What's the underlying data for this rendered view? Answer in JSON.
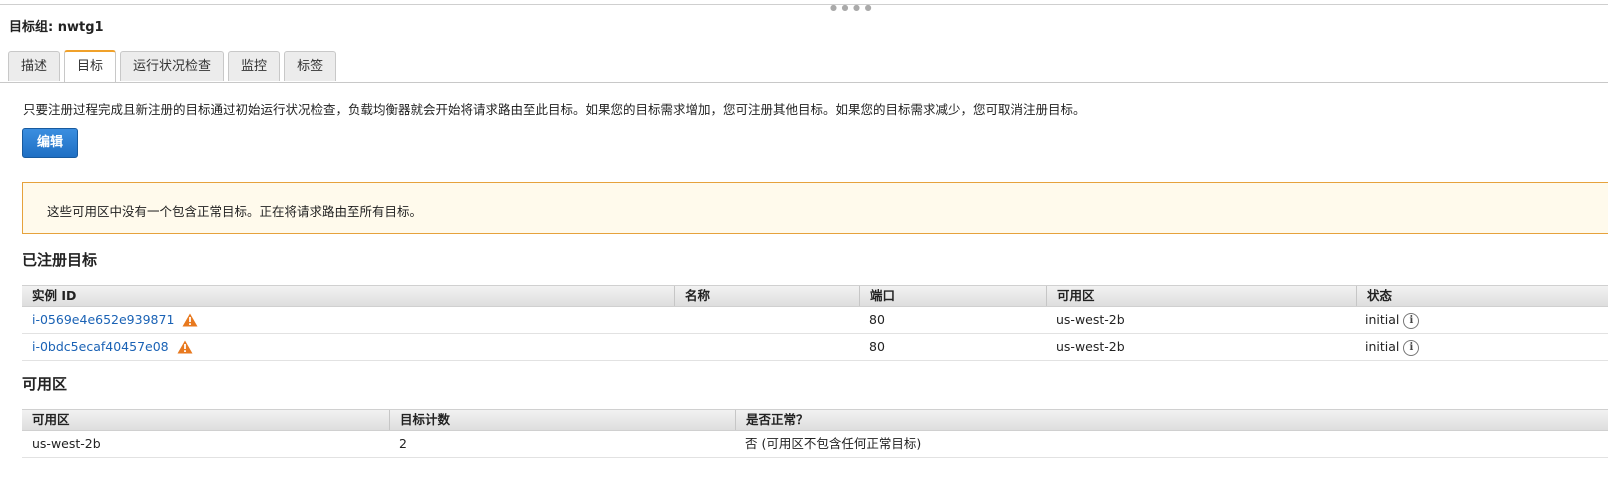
{
  "panel": {
    "title": "目标组: nwtg1"
  },
  "tabs": [
    {
      "label": "描述"
    },
    {
      "label": "目标",
      "active": true
    },
    {
      "label": "运行状况检查"
    },
    {
      "label": "监控"
    },
    {
      "label": "标签"
    }
  ],
  "targets_tab": {
    "description": "只要注册过程完成且新注册的目标通过初始运行状况检查，负载均衡器就会开始将请求路由至此目标。如果您的目标需求增加，您可注册其他目标。如果您的目标需求减少，您可取消注册目标。",
    "edit_label": "编辑",
    "alert": "这些可用区中没有一个包含正常目标。正在将请求路由至所有目标。"
  },
  "registered_targets": {
    "title": "已注册目标",
    "columns": [
      "实例 ID",
      "名称",
      "端口",
      "可用区",
      "状态"
    ],
    "rows": [
      {
        "instance_id": "i-0569e4e652e939871",
        "name": "",
        "port": "80",
        "az": "us-west-2b",
        "status": "initial"
      },
      {
        "instance_id": "i-0bdc5ecaf40457e08",
        "name": "",
        "port": "80",
        "az": "us-west-2b",
        "status": "initial"
      }
    ]
  },
  "availability_zones": {
    "title": "可用区",
    "columns": [
      "可用区",
      "目标计数",
      "是否正常？"
    ],
    "rows": [
      {
        "zone": "us-west-2b",
        "count": "2",
        "healthy": "否 (可用区不包含任何正常目标)"
      }
    ]
  },
  "colors": {
    "accent_tab": "#f0a12a",
    "link": "#1a62b5",
    "button": "#1f6fc4",
    "alert_border": "#e6a23c",
    "warning": "#e8791f"
  },
  "icons": {
    "warning": "warning-triangle-icon",
    "info": "info-circle-icon"
  }
}
